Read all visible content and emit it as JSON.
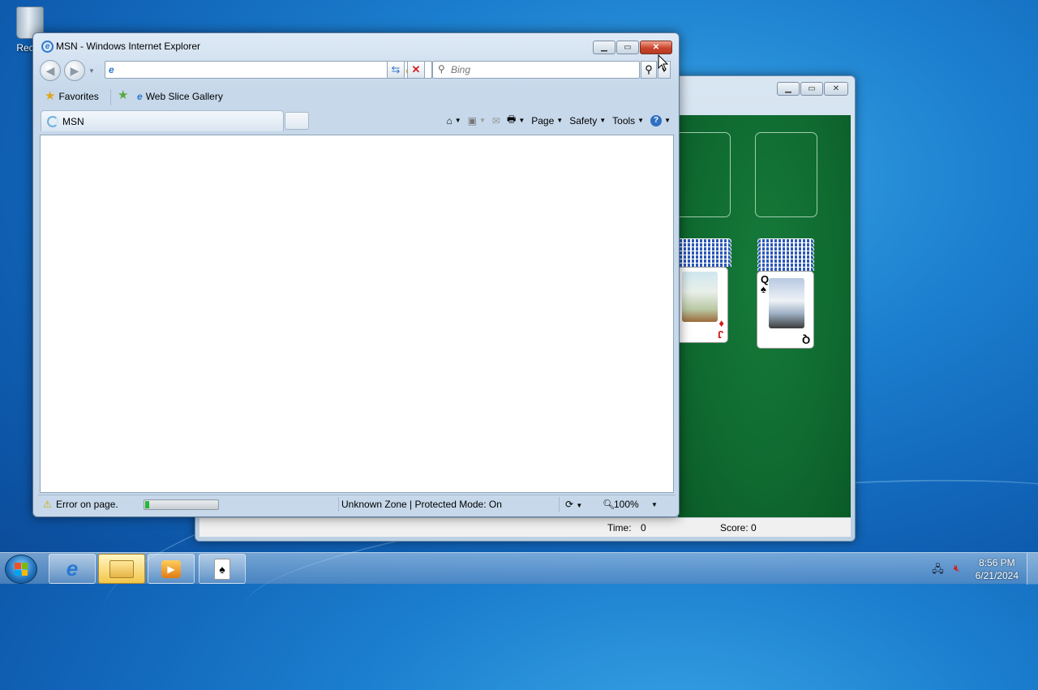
{
  "desktop": {
    "recycle_bin_label": "Recyc"
  },
  "solitaire": {
    "status": {
      "time_label": "Time:",
      "time_value": "0",
      "score_label": "Score: 0"
    },
    "cards": [
      {
        "rank": "J",
        "suit": "♦",
        "color": "#d11a1a"
      },
      {
        "rank": "Q",
        "suit": "♠",
        "color": "#000000"
      }
    ]
  },
  "ie": {
    "title": "MSN - Windows Internet Explorer",
    "address": {
      "value": "",
      "placeholder": ""
    },
    "search": {
      "placeholder": "Bing"
    },
    "favorites_label": "Favorites",
    "web_slice_gallery_label": "Web Slice Gallery",
    "tab_label": "MSN",
    "commands": {
      "page": "Page",
      "safety": "Safety",
      "tools": "Tools"
    },
    "status": {
      "error_text": "Error on page.",
      "zone_text": "Unknown Zone | Protected Mode: On",
      "zoom_text": "100%",
      "progress_fraction": 0.05
    }
  },
  "taskbar": {
    "time": "8:56 PM",
    "date": "6/21/2024"
  },
  "icons": {
    "ie": "internet-explorer-icon",
    "explorer": "folder-icon",
    "media": "media-player-icon",
    "solitaire": "solitaire-icon"
  }
}
